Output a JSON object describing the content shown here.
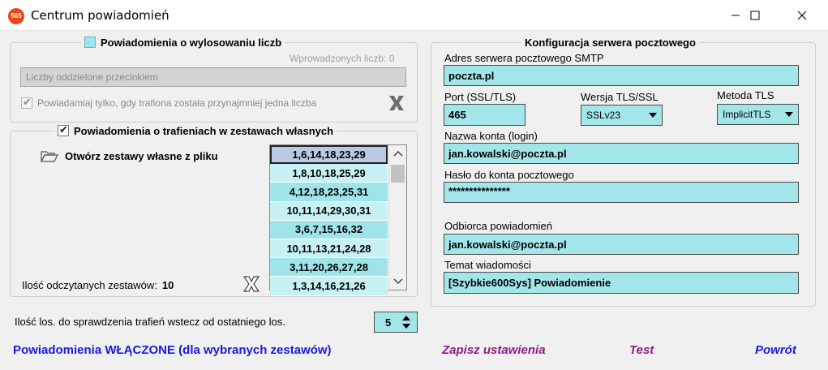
{
  "window": {
    "title": "Centrum powiadomień",
    "app_icon_text": "565"
  },
  "draw_group": {
    "legend": "Powiadomienia o wylosowaniu liczb",
    "entered_count_label": "Wprowadzonych liczb: 0",
    "numbers_placeholder": "Liczby oddzielone przecinkiem",
    "notify_only_hit_label": "Powiadamiaj tylko, gdy trafiona została przynajmniej jedna liczba"
  },
  "own_sets_group": {
    "legend": "Powiadomienia o trafieniach w zestawach własnych",
    "open_file_label": "Otwórz zestawy własne z pliku",
    "read_count_label": "Ilość odczytanych zestawów:",
    "read_count_value": "10",
    "sets": [
      "1,6,14,18,23,29",
      "1,8,10,18,25,29",
      "4,12,18,23,25,31",
      "10,11,14,29,30,31",
      "3,6,7,15,16,32",
      "10,11,13,21,24,28",
      "3,11,20,26,27,28",
      "1,3,14,16,21,26"
    ]
  },
  "check_back": {
    "label": "Ilość los. do sprawdzenia trafień wstecz od ostatniego los.",
    "value": "5"
  },
  "mail_config": {
    "legend": "Konfiguracja serwera pocztowego",
    "smtp_label": "Adres serwera pocztowego SMTP",
    "smtp_value": "poczta.pl",
    "port_label": "Port (SSL/TLS)",
    "port_value": "465",
    "tls_version_label": "Wersja TLS/SSL",
    "tls_version_value": "SSLv23",
    "tls_method_label": "Metoda TLS",
    "tls_method_value": "ImplicitTLS",
    "login_label": "Nazwa konta (login)",
    "login_value": "jan.kowalski@poczta.pl",
    "password_label": "Hasło do konta pocztowego",
    "password_value": "***************",
    "recipient_label": "Odbiorca powiadomień",
    "recipient_value": "jan.kowalski@poczta.pl",
    "subject_label": "Temat wiadomości",
    "subject_value": "[Szybkie600Sys] Powiadomienie"
  },
  "footer": {
    "status": "Powiadomienia WŁĄCZONE (dla wybranych zestawów)",
    "save_label": "Zapisz ustawienia",
    "test_label": "Test",
    "back_label": "Powrót"
  },
  "colors": {
    "field_bg": "#a2e6ea",
    "status_blue": "#1a1ae6",
    "action_purple": "#8a1e8a"
  }
}
